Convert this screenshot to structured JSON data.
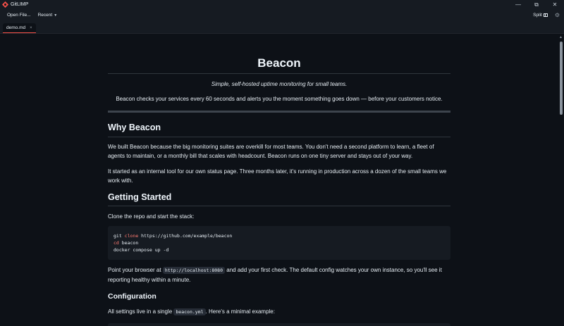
{
  "window": {
    "title": "GitLIMP",
    "controls": [
      "—",
      "⧉",
      "✕"
    ],
    "accent": "#f85149"
  },
  "toolbar": {
    "open_label": "Open File...",
    "recent_label": "Recent",
    "split_label": "Split"
  },
  "tabs": [
    {
      "label": "demo.md",
      "close": "×"
    }
  ],
  "doc": {
    "title": "Beacon",
    "tagline": "Simple, self-hosted uptime monitoring for small teams.",
    "summary": "Beacon checks your services every 60 seconds and alerts you the moment something goes down — before your customers notice.",
    "why_heading": "Why Beacon",
    "why_p1": "We built Beacon because the big monitoring suites are overkill for most teams. You don't need a second platform to learn, a fleet of agents to maintain, or a monthly bill that scales with headcount. Beacon runs on one tiny server and stays out of your way.",
    "why_p2": "It started as an internal tool for our own status page. Three months later, it's running in production across a dozen of the small teams we work with.",
    "getting_started_heading": "Getting Started",
    "clone_text": "Clone the repo and start the stack:",
    "code": {
      "line1_cmd": "git",
      "line1_kw": "clone",
      "line1_rest": "https://github.com/example/beacon",
      "line2_kw": "cd",
      "line2_rest": "beacon",
      "line3": "docker compose up -d"
    },
    "browser_text_a": "Point your browser at",
    "browser_code": "http://localhost:8080",
    "browser_text_b": "and add your first check. The default config watches your own instance, so you'll see it reporting healthy within a minute.",
    "config_heading": "Configuration",
    "config_text_a": "All settings live in a single",
    "config_code": "beacon.yml",
    "config_text_b": ". Here's a minimal example:"
  }
}
